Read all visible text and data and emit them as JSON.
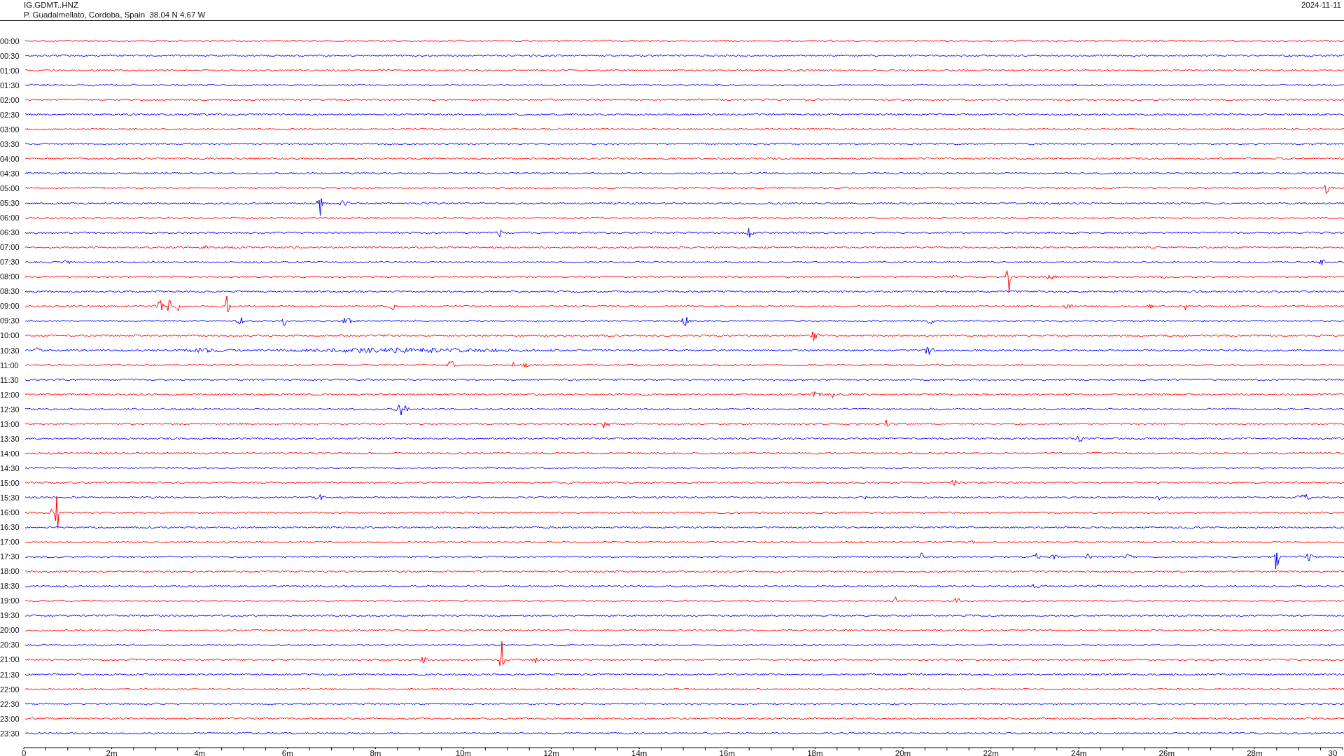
{
  "station": {
    "code": "IG.GDMT..HNZ",
    "location": "P. Guadalmellato, Cordoba, Spain  38.04 N 4.67 W",
    "date": "2024-11-11"
  },
  "rows": [
    {
      "time": "00:00",
      "color": "#ff0000"
    },
    {
      "time": "00:30",
      "color": "#0000ff"
    },
    {
      "time": "01:00",
      "color": "#ff0000"
    },
    {
      "time": "01:30",
      "color": "#0000ff"
    },
    {
      "time": "02:00",
      "color": "#ff0000"
    },
    {
      "time": "02:30",
      "color": "#0000ff"
    },
    {
      "time": "03:00",
      "color": "#ff0000"
    },
    {
      "time": "03:30",
      "color": "#0000ff"
    },
    {
      "time": "04:00",
      "color": "#ff0000"
    },
    {
      "time": "04:30",
      "color": "#0000ff"
    },
    {
      "time": "05:00",
      "color": "#ff0000"
    },
    {
      "time": "05:30",
      "color": "#0000ff"
    },
    {
      "time": "06:00",
      "color": "#ff0000"
    },
    {
      "time": "06:30",
      "color": "#0000ff"
    },
    {
      "time": "07:00",
      "color": "#ff0000"
    },
    {
      "time": "07:30",
      "color": "#0000ff"
    },
    {
      "time": "08:00",
      "color": "#ff0000"
    },
    {
      "time": "08:30",
      "color": "#0000ff"
    },
    {
      "time": "09:00",
      "color": "#ff0000"
    },
    {
      "time": "09:30",
      "color": "#0000ff"
    },
    {
      "time": "10:00",
      "color": "#ff0000"
    },
    {
      "time": "10:30",
      "color": "#0000ff"
    },
    {
      "time": "11:00",
      "color": "#ff0000"
    },
    {
      "time": "11:30",
      "color": "#0000ff"
    },
    {
      "time": "12:00",
      "color": "#ff0000"
    },
    {
      "time": "12:30",
      "color": "#0000ff"
    },
    {
      "time": "13:00",
      "color": "#ff0000"
    },
    {
      "time": "13:30",
      "color": "#0000ff"
    },
    {
      "time": "14:00",
      "color": "#ff0000"
    },
    {
      "time": "14:30",
      "color": "#0000ff"
    },
    {
      "time": "15:00",
      "color": "#ff0000"
    },
    {
      "time": "15:30",
      "color": "#0000ff"
    },
    {
      "time": "16:00",
      "color": "#ff0000"
    },
    {
      "time": "16:30",
      "color": "#0000ff"
    },
    {
      "time": "17:00",
      "color": "#ff0000"
    },
    {
      "time": "17:30",
      "color": "#0000ff"
    },
    {
      "time": "18:00",
      "color": "#ff0000"
    },
    {
      "time": "18:30",
      "color": "#0000ff"
    },
    {
      "time": "19:00",
      "color": "#ff0000"
    },
    {
      "time": "19:30",
      "color": "#0000ff"
    },
    {
      "time": "20:00",
      "color": "#ff0000"
    },
    {
      "time": "20:30",
      "color": "#0000ff"
    },
    {
      "time": "21:00",
      "color": "#ff0000"
    },
    {
      "time": "21:30",
      "color": "#0000ff"
    },
    {
      "time": "22:00",
      "color": "#ff0000"
    },
    {
      "time": "22:30",
      "color": "#0000ff"
    },
    {
      "time": "23:00",
      "color": "#ff0000"
    },
    {
      "time": "23:30",
      "color": "#0000ff"
    }
  ],
  "axis": {
    "labels": [
      "0",
      "2m",
      "4m",
      "6m",
      "8m",
      "10m",
      "12m",
      "14m",
      "16m",
      "18m",
      "20m",
      "22m",
      "24m",
      "26m",
      "28m",
      "30"
    ]
  }
}
